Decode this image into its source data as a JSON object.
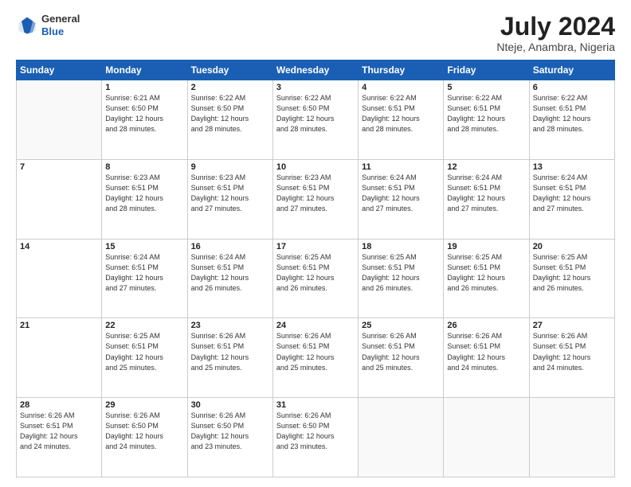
{
  "header": {
    "logo_line1": "General",
    "logo_line2": "Blue",
    "title": "July 2024",
    "subtitle": "Nteje, Anambra, Nigeria"
  },
  "days_of_week": [
    "Sunday",
    "Monday",
    "Tuesday",
    "Wednesday",
    "Thursday",
    "Friday",
    "Saturday"
  ],
  "weeks": [
    [
      {
        "day": "",
        "info": ""
      },
      {
        "day": "1",
        "info": "Sunrise: 6:21 AM\nSunset: 6:50 PM\nDaylight: 12 hours\nand 28 minutes."
      },
      {
        "day": "2",
        "info": "Sunrise: 6:22 AM\nSunset: 6:50 PM\nDaylight: 12 hours\nand 28 minutes."
      },
      {
        "day": "3",
        "info": "Sunrise: 6:22 AM\nSunset: 6:50 PM\nDaylight: 12 hours\nand 28 minutes."
      },
      {
        "day": "4",
        "info": "Sunrise: 6:22 AM\nSunset: 6:51 PM\nDaylight: 12 hours\nand 28 minutes."
      },
      {
        "day": "5",
        "info": "Sunrise: 6:22 AM\nSunset: 6:51 PM\nDaylight: 12 hours\nand 28 minutes."
      },
      {
        "day": "6",
        "info": "Sunrise: 6:22 AM\nSunset: 6:51 PM\nDaylight: 12 hours\nand 28 minutes."
      }
    ],
    [
      {
        "day": "7",
        "info": ""
      },
      {
        "day": "8",
        "info": "Sunrise: 6:23 AM\nSunset: 6:51 PM\nDaylight: 12 hours\nand 28 minutes."
      },
      {
        "day": "9",
        "info": "Sunrise: 6:23 AM\nSunset: 6:51 PM\nDaylight: 12 hours\nand 27 minutes."
      },
      {
        "day": "10",
        "info": "Sunrise: 6:23 AM\nSunset: 6:51 PM\nDaylight: 12 hours\nand 27 minutes."
      },
      {
        "day": "11",
        "info": "Sunrise: 6:24 AM\nSunset: 6:51 PM\nDaylight: 12 hours\nand 27 minutes."
      },
      {
        "day": "12",
        "info": "Sunrise: 6:24 AM\nSunset: 6:51 PM\nDaylight: 12 hours\nand 27 minutes."
      },
      {
        "day": "13",
        "info": "Sunrise: 6:24 AM\nSunset: 6:51 PM\nDaylight: 12 hours\nand 27 minutes."
      }
    ],
    [
      {
        "day": "14",
        "info": ""
      },
      {
        "day": "15",
        "info": "Sunrise: 6:24 AM\nSunset: 6:51 PM\nDaylight: 12 hours\nand 27 minutes."
      },
      {
        "day": "16",
        "info": "Sunrise: 6:24 AM\nSunset: 6:51 PM\nDaylight: 12 hours\nand 26 minutes."
      },
      {
        "day": "17",
        "info": "Sunrise: 6:25 AM\nSunset: 6:51 PM\nDaylight: 12 hours\nand 26 minutes."
      },
      {
        "day": "18",
        "info": "Sunrise: 6:25 AM\nSunset: 6:51 PM\nDaylight: 12 hours\nand 26 minutes."
      },
      {
        "day": "19",
        "info": "Sunrise: 6:25 AM\nSunset: 6:51 PM\nDaylight: 12 hours\nand 26 minutes."
      },
      {
        "day": "20",
        "info": "Sunrise: 6:25 AM\nSunset: 6:51 PM\nDaylight: 12 hours\nand 26 minutes."
      }
    ],
    [
      {
        "day": "21",
        "info": ""
      },
      {
        "day": "22",
        "info": "Sunrise: 6:25 AM\nSunset: 6:51 PM\nDaylight: 12 hours\nand 25 minutes."
      },
      {
        "day": "23",
        "info": "Sunrise: 6:26 AM\nSunset: 6:51 PM\nDaylight: 12 hours\nand 25 minutes."
      },
      {
        "day": "24",
        "info": "Sunrise: 6:26 AM\nSunset: 6:51 PM\nDaylight: 12 hours\nand 25 minutes."
      },
      {
        "day": "25",
        "info": "Sunrise: 6:26 AM\nSunset: 6:51 PM\nDaylight: 12 hours\nand 25 minutes."
      },
      {
        "day": "26",
        "info": "Sunrise: 6:26 AM\nSunset: 6:51 PM\nDaylight: 12 hours\nand 24 minutes."
      },
      {
        "day": "27",
        "info": "Sunrise: 6:26 AM\nSunset: 6:51 PM\nDaylight: 12 hours\nand 24 minutes."
      }
    ],
    [
      {
        "day": "28",
        "info": "Sunrise: 6:26 AM\nSunset: 6:51 PM\nDaylight: 12 hours\nand 24 minutes."
      },
      {
        "day": "29",
        "info": "Sunrise: 6:26 AM\nSunset: 6:50 PM\nDaylight: 12 hours\nand 24 minutes."
      },
      {
        "day": "30",
        "info": "Sunrise: 6:26 AM\nSunset: 6:50 PM\nDaylight: 12 hours\nand 23 minutes."
      },
      {
        "day": "31",
        "info": "Sunrise: 6:26 AM\nSunset: 6:50 PM\nDaylight: 12 hours\nand 23 minutes."
      },
      {
        "day": "",
        "info": ""
      },
      {
        "day": "",
        "info": ""
      },
      {
        "day": "",
        "info": ""
      }
    ]
  ]
}
